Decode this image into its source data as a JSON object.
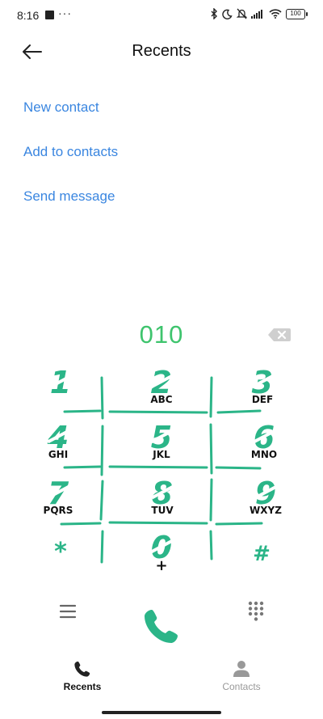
{
  "status_bar": {
    "time": "8:16",
    "dots": "···",
    "battery": "100"
  },
  "header": {
    "title": "Recents"
  },
  "actions": {
    "new_contact": "New contact",
    "add_to_contacts": "Add to contacts",
    "send_message": "Send message"
  },
  "dialer": {
    "number": "010"
  },
  "keypad": {
    "keys": [
      {
        "digit": "1",
        "letters": ""
      },
      {
        "digit": "2",
        "letters": "ABC"
      },
      {
        "digit": "3",
        "letters": "DEF"
      },
      {
        "digit": "4",
        "letters": "GHI"
      },
      {
        "digit": "5",
        "letters": "JKL"
      },
      {
        "digit": "6",
        "letters": "MNO"
      },
      {
        "digit": "7",
        "letters": "PQRS"
      },
      {
        "digit": "8",
        "letters": "TUV"
      },
      {
        "digit": "9",
        "letters": "WXYZ"
      },
      {
        "digit": "*",
        "letters": ""
      },
      {
        "digit": "0",
        "letters": "+"
      },
      {
        "digit": "#",
        "letters": ""
      }
    ]
  },
  "bottom_nav": {
    "recents": "Recents",
    "contacts": "Contacts"
  },
  "colors": {
    "accent_blue": "#3a86e0",
    "dial_green": "#3ec46d",
    "keypad_green": "#2bb588",
    "inactive_gray": "#999999"
  },
  "icons": {
    "back": "arrow-left-icon",
    "backspace": "backspace-icon",
    "menu": "hamburger-menu-icon",
    "call": "phone-icon",
    "dialpad": "dialpad-icon",
    "recents": "phone-icon",
    "contacts": "person-icon"
  }
}
